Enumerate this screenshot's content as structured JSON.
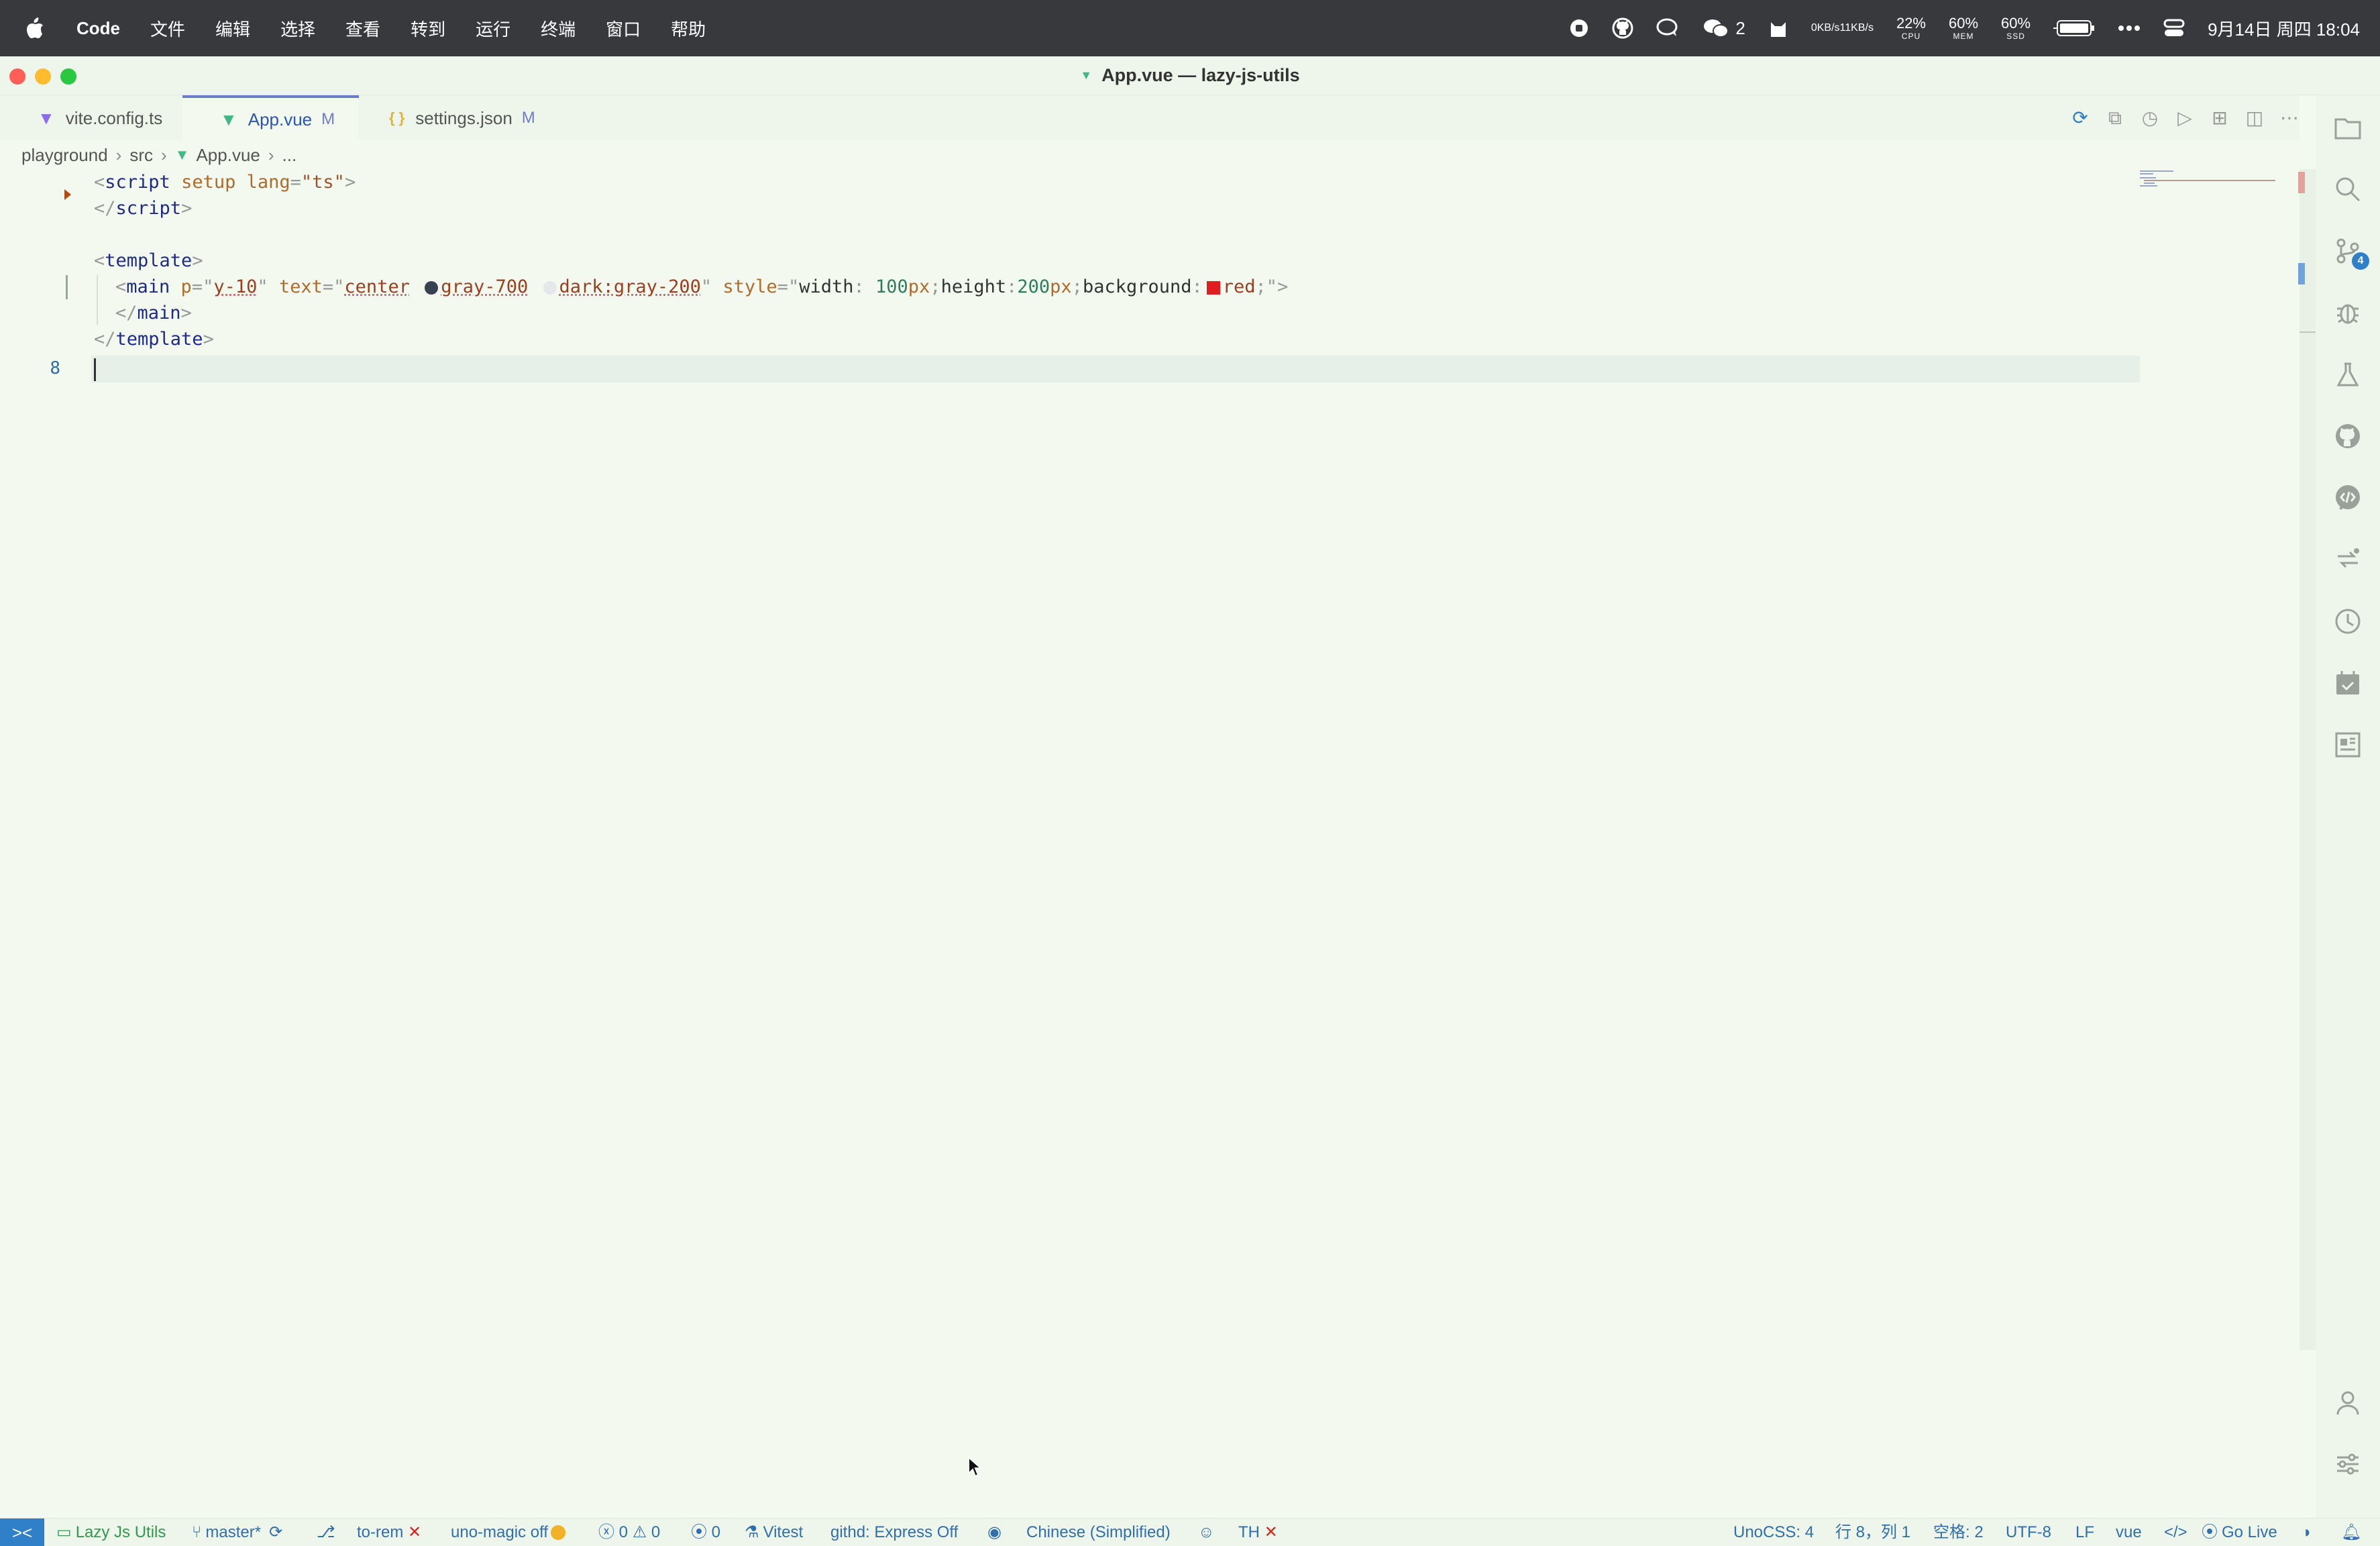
{
  "menubar": {
    "app_name": "Code",
    "menus": [
      "文件",
      "编辑",
      "选择",
      "查看",
      "转到",
      "运行",
      "终端",
      "窗口",
      "帮助"
    ],
    "wechat_count": "2",
    "net_up": "0KB/s",
    "net_down": "11KB/s",
    "cpu": {
      "value": "22%",
      "label": "CPU"
    },
    "mem": {
      "value": "60%",
      "label": "MEM"
    },
    "ssd": {
      "value": "60%",
      "label": "SSD"
    },
    "datetime": "9月14日 周四  18:04"
  },
  "window": {
    "title": "App.vue — lazy-js-utils"
  },
  "tabs": [
    {
      "label": "vite.config.ts",
      "icon": "vite-icon",
      "modified": ""
    },
    {
      "label": "App.vue",
      "icon": "vue-icon",
      "modified": "M"
    },
    {
      "label": "settings.json",
      "icon": "json-icon",
      "modified": "M"
    }
  ],
  "breadcrumb": {
    "items": [
      "playground",
      "src",
      "App.vue",
      "..."
    ]
  },
  "editor": {
    "current_line_number": "8",
    "lines": {
      "l1_open": "<",
      "l1_tag": "script",
      "l1_attr1": " setup",
      "l1_attr2": " lang",
      "l1_eq": "=",
      "l1_val": "\"ts\"",
      "l1_close": ">",
      "l2": "script",
      "l4": "template",
      "main_tag": "main",
      "main_p_attr": " p",
      "main_p_val": "y-10",
      "main_text_attr": " text",
      "main_text_v1": "center",
      "main_text_v2": "gray-700",
      "main_text_v3": "dark:gray-200",
      "main_style_attr": " style",
      "style_width_prop": "width",
      "style_width_num": "100",
      "style_width_unit": "px",
      "style_height_prop": "height",
      "style_height_num": "200",
      "style_height_unit": "px",
      "style_bg_prop": "background",
      "style_bg_val": "red",
      "l6": "main",
      "l7": "template"
    },
    "swatch_colors": {
      "gray700": "#374151",
      "gray200": "#e5e7eb",
      "red": "#e11d1d"
    }
  },
  "activity_bar": {
    "source_control_badge": "4"
  },
  "statusbar": {
    "project": "Lazy Js Utils",
    "branch": "master*",
    "to_rem": "to-rem",
    "uno_magic": "uno-magic off",
    "errors": "0",
    "warnings": "0",
    "ports": "0",
    "vitest": "Vitest",
    "githd": "githd: Express Off",
    "language_pack": "Chinese (Simplified)",
    "th": "TH",
    "unocss": "UnoCSS: 4",
    "position": "行 8，列 1",
    "spaces": "空格: 2",
    "encoding": "UTF-8",
    "eol": "LF",
    "language": "vue",
    "go_live": "Go Live"
  },
  "colors": {
    "accent": "#2f7fc9",
    "editor_bg": "#f3f9ef",
    "menubar_bg": "#37393d",
    "error_red": "#e0201b",
    "vue_green": "#41b883"
  }
}
